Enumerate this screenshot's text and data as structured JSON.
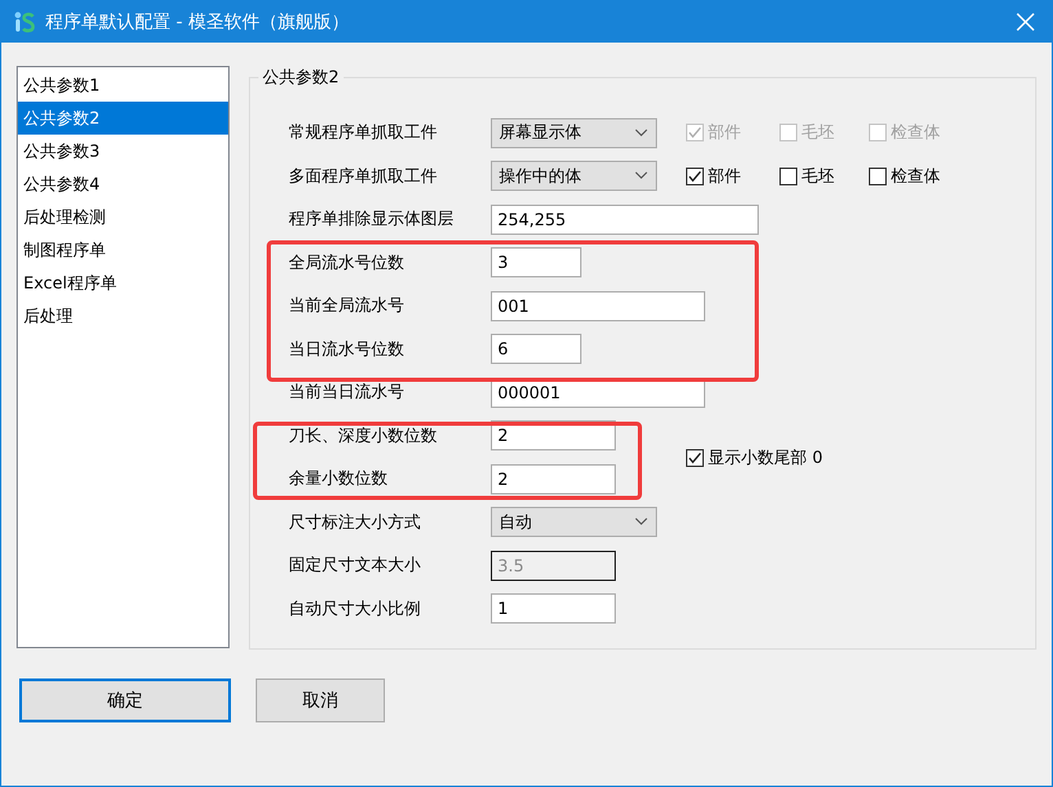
{
  "window": {
    "title": "程序单默认配置 - 模圣软件（旗舰版）"
  },
  "sidebar": {
    "items": [
      {
        "label": "公共参数1",
        "selected": false
      },
      {
        "label": "公共参数2",
        "selected": true
      },
      {
        "label": "公共参数3",
        "selected": false
      },
      {
        "label": "公共参数4",
        "selected": false
      },
      {
        "label": "后处理检测",
        "selected": false
      },
      {
        "label": "制图程序单",
        "selected": false
      },
      {
        "label": "Excel程序单",
        "selected": false
      },
      {
        "label": "后处理",
        "selected": false
      }
    ]
  },
  "group": {
    "title": "公共参数2",
    "rows": [
      {
        "label": "常规程序单抓取工件",
        "kind": "combo",
        "value": "屏幕显示体",
        "checks": [
          {
            "label": "部件",
            "checked": true,
            "disabled": true
          },
          {
            "label": "毛坯",
            "checked": false,
            "disabled": true
          },
          {
            "label": "检查体",
            "checked": false,
            "disabled": true
          }
        ]
      },
      {
        "label": "多面程序单抓取工件",
        "kind": "combo",
        "value": "操作中的体",
        "checks": [
          {
            "label": "部件",
            "checked": true,
            "disabled": false
          },
          {
            "label": "毛坯",
            "checked": false,
            "disabled": false
          },
          {
            "label": "检查体",
            "checked": false,
            "disabled": false
          }
        ]
      },
      {
        "label": "程序单排除显示体图层",
        "kind": "widefield",
        "value": "254,255"
      },
      {
        "label": "全局流水号位数",
        "kind": "shortfield",
        "value": "3"
      },
      {
        "label": "当前全局流水号",
        "kind": "midfield",
        "value": "001"
      },
      {
        "label": "当日流水号位数",
        "kind": "shortfield",
        "value": "6"
      },
      {
        "label": "当前当日流水号",
        "kind": "midfield",
        "value": "000001"
      },
      {
        "label": "刀长、深度小数位数",
        "kind": "field",
        "value": "2"
      },
      {
        "label": "余量小数位数",
        "kind": "field",
        "value": "2"
      },
      {
        "label": "尺寸标注大小方式",
        "kind": "combo",
        "value": "自动"
      },
      {
        "label": "固定尺寸文本大小",
        "kind": "field",
        "value": "3.5",
        "disabled": true
      },
      {
        "label": "自动尺寸大小比例",
        "kind": "field",
        "value": "1"
      }
    ],
    "trailing_check": {
      "label": "显示小数尾部 0",
      "checked": true
    }
  },
  "buttons": [
    {
      "label": "确定",
      "focused": true
    },
    {
      "label": "取消",
      "focused": false
    }
  ]
}
